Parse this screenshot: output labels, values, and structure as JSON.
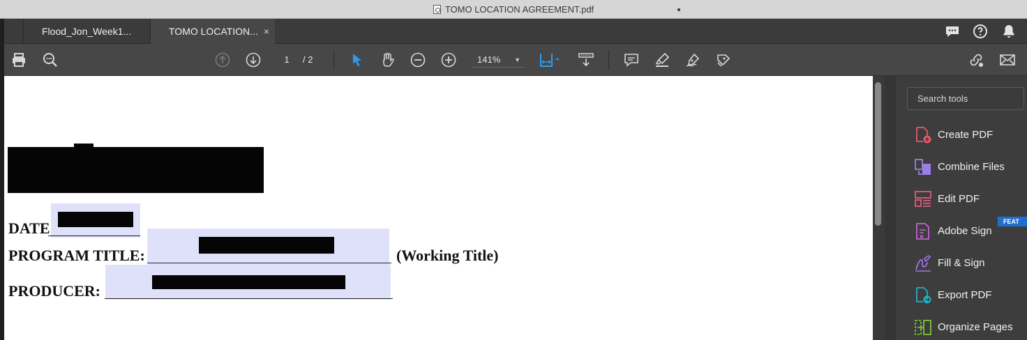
{
  "window": {
    "title": "TOMO LOCATION AGREEMENT.pdf"
  },
  "tabs": [
    {
      "label": "Flood_Jon_Week1..."
    },
    {
      "label": "TOMO LOCATION...",
      "close": "×"
    }
  ],
  "toolbar": {
    "page_current": "1",
    "page_total": "/ 2",
    "zoom": "141%",
    "zoom_caret": "▼"
  },
  "document": {
    "date_label": "DATE",
    "program_title_label": "PROGRAM TITLE:",
    "working_title": "(Working Title)",
    "producer_label": "PRODUCER:"
  },
  "tools_panel": {
    "search_placeholder": "Search tools",
    "items": [
      {
        "label": "Create PDF",
        "color": "#e8576b"
      },
      {
        "label": "Combine Files",
        "color": "#9b7de8"
      },
      {
        "label": "Edit PDF",
        "color": "#e8577f"
      },
      {
        "label": "Adobe Sign",
        "color": "#c064d8"
      },
      {
        "label": "Fill & Sign",
        "color": "#a770e8"
      },
      {
        "label": "Export PDF",
        "color": "#1fb2c9"
      },
      {
        "label": "Organize Pages",
        "color": "#7cc63c"
      }
    ],
    "feature_badge": "FEAT"
  },
  "colors": {
    "accent": "#2d9cf0",
    "toolbar_bg": "#474747",
    "field_highlight": "#dfe1fb"
  }
}
